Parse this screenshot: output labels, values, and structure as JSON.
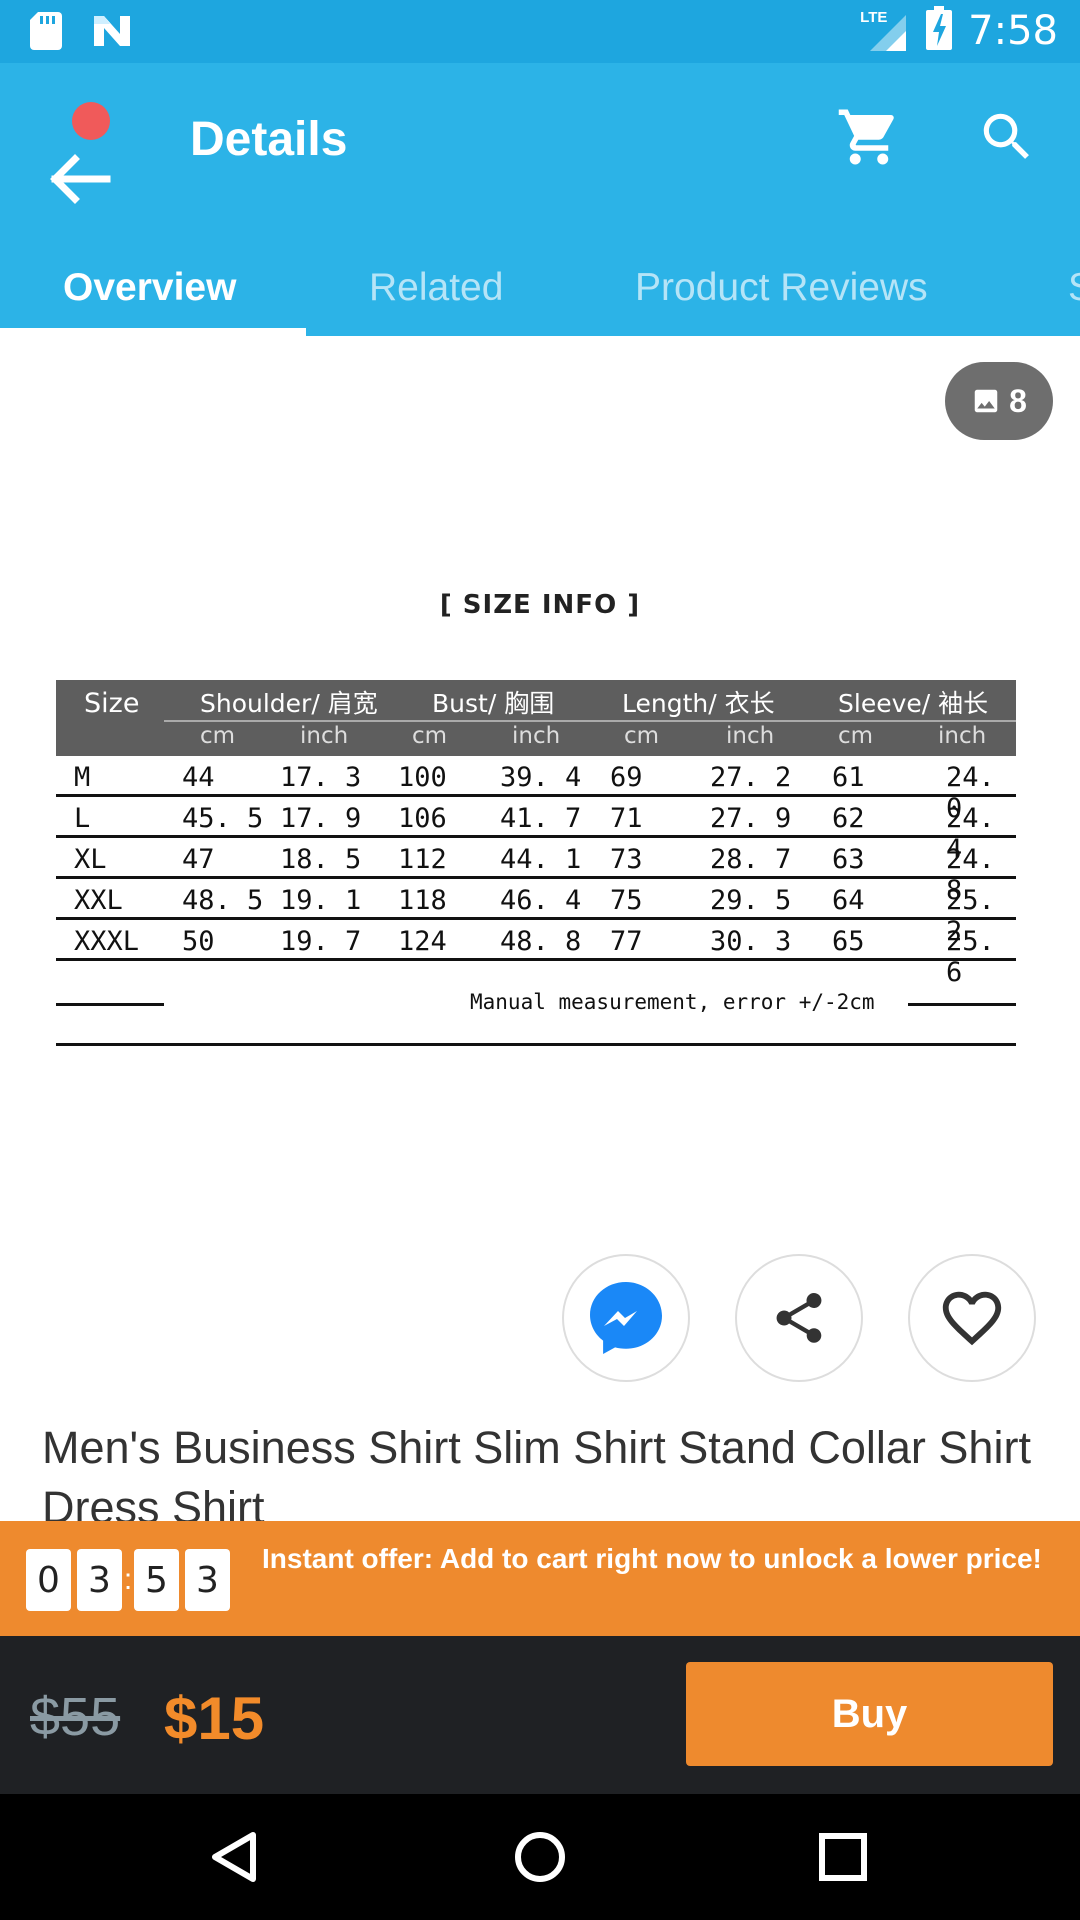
{
  "status_bar": {
    "time": "7:58",
    "network": "LTE"
  },
  "header": {
    "title": "Details"
  },
  "tabs": [
    {
      "label": "Overview"
    },
    {
      "label": "Related"
    },
    {
      "label": "Product Reviews"
    },
    {
      "label": "S"
    }
  ],
  "gallery": {
    "image_count": "8",
    "size_info": {
      "title": "[ SIZE INFO ]",
      "size_header": "Size",
      "groups": [
        "Shoulder/ 肩宽",
        "Bust/ 胸围",
        "Length/ 衣长",
        "Sleeve/ 袖长"
      ],
      "units": [
        "cm",
        "inch",
        "cm",
        "inch",
        "cm",
        "inch",
        "cm",
        "inch"
      ],
      "rows": [
        [
          "M",
          "44",
          "17. 3",
          "100",
          "39. 4",
          "69",
          "27. 2",
          "61",
          "24. 0"
        ],
        [
          "L",
          "45. 5",
          "17. 9",
          "106",
          "41. 7",
          "71",
          "27. 9",
          "62",
          "24. 4"
        ],
        [
          "XL",
          "47",
          "18. 5",
          "112",
          "44. 1",
          "73",
          "28. 7",
          "63",
          "24. 8"
        ],
        [
          "XXL",
          "48. 5",
          "19. 1",
          "118",
          "46. 4",
          "75",
          "29. 5",
          "64",
          "25. 2"
        ],
        [
          "XXXL",
          "50",
          "19. 7",
          "124",
          "48. 8",
          "77",
          "30. 3",
          "65",
          "25. 6"
        ]
      ],
      "note": "Manual measurement, error +/-2cm"
    }
  },
  "product": {
    "title": "Men's Business Shirt Slim Shirt Stand Collar Shirt Dress Shirt"
  },
  "offer": {
    "timer": [
      "0",
      "3",
      "5",
      "3"
    ],
    "separator": ":",
    "text": "Instant offer: Add to cart right now to unlock a lower price!"
  },
  "pricing": {
    "original": "$55",
    "current": "$15",
    "buy_label": "Buy"
  },
  "colors": {
    "status_bar": "#1ea6df",
    "app_bar": "#2cb3e7",
    "accent_orange": "#ee8a2e",
    "buy_bar": "#1f2124",
    "notification_dot": "#f05a5a",
    "messenger_blue": "#1a88f7"
  },
  "icons": {
    "sd_card": "sd-card-icon",
    "notification": "n-logo-icon",
    "signal": "signal-icon",
    "battery": "battery-charging-icon",
    "back": "back-arrow-icon",
    "cart": "cart-icon",
    "search": "search-icon",
    "gallery": "image-icon",
    "messenger": "messenger-icon",
    "share": "share-icon",
    "favorite": "heart-icon",
    "nav_back": "triangle-back-icon",
    "nav_home": "circle-home-icon",
    "nav_recents": "square-recents-icon"
  }
}
